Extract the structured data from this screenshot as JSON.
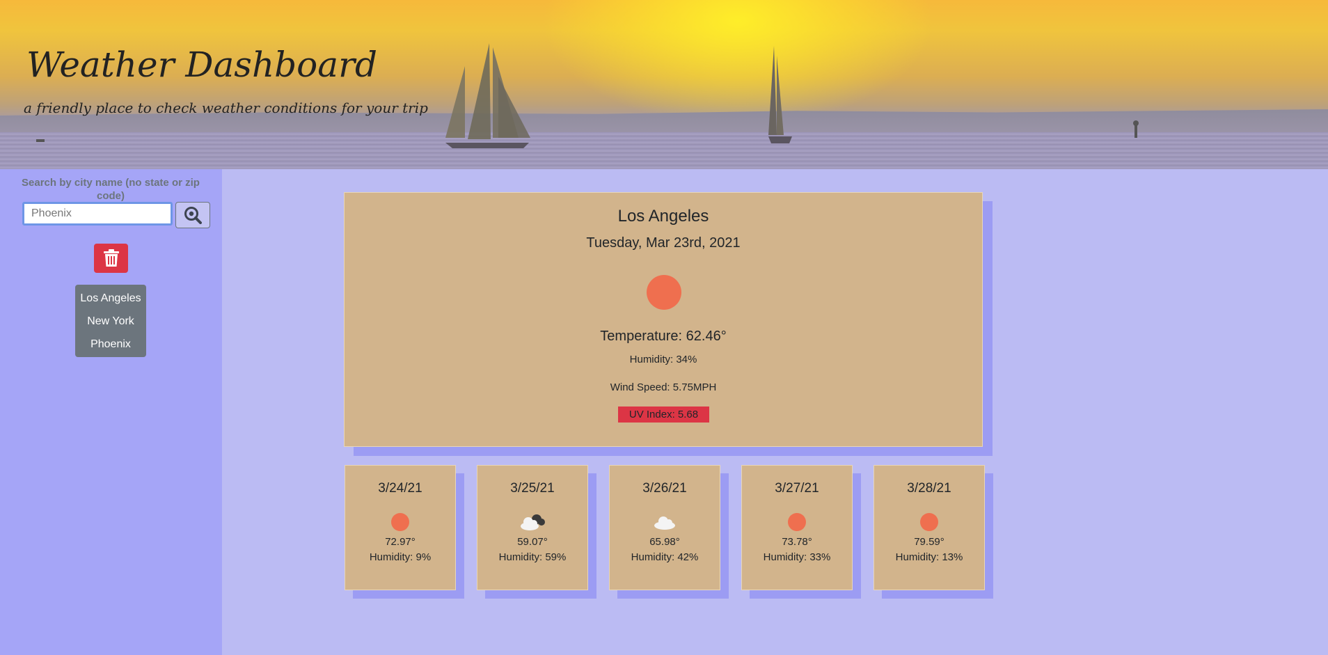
{
  "header": {
    "title": "Weather Dashboard",
    "subtitle": "a friendly place to check weather conditions for your trip"
  },
  "sidebar": {
    "search_label": "Search by city name (no state or zip code)",
    "search_placeholder": "Phoenix",
    "search_button_icon": "search-icon",
    "clear_button_icon": "trash-icon",
    "history": [
      {
        "label": "Los Angeles"
      },
      {
        "label": "New York"
      },
      {
        "label": "Phoenix"
      }
    ]
  },
  "current": {
    "city": "Los Angeles",
    "date": "Tuesday, Mar 23rd, 2021",
    "icon": "sun-icon",
    "temperature": "Temperature: 62.46°",
    "humidity": "Humidity: 34%",
    "wind": "Wind Speed: 5.75MPH",
    "uv": "UV Index: 5.68"
  },
  "forecast": [
    {
      "date": "3/24/21",
      "icon": "sun-icon",
      "temp": "72.97°",
      "humidity": "Humidity: 9%"
    },
    {
      "date": "3/25/21",
      "icon": "cloudy-icon",
      "temp": "59.07°",
      "humidity": "Humidity: 59%"
    },
    {
      "date": "3/26/21",
      "icon": "cloud-icon",
      "temp": "65.98°",
      "humidity": "Humidity: 42%"
    },
    {
      "date": "3/27/21",
      "icon": "sun-icon",
      "temp": "73.78°",
      "humidity": "Humidity: 33%"
    },
    {
      "date": "3/28/21",
      "icon": "sun-icon",
      "temp": "79.59°",
      "humidity": "Humidity: 13%"
    }
  ],
  "colors": {
    "page_bg": "#bbbbf3",
    "sidebar_bg": "#a5a5f7",
    "card_bg": "#d2b48c",
    "uv_badge": "#dc3545",
    "trash_button": "#dc3545",
    "sun": "#ef6f4f"
  }
}
